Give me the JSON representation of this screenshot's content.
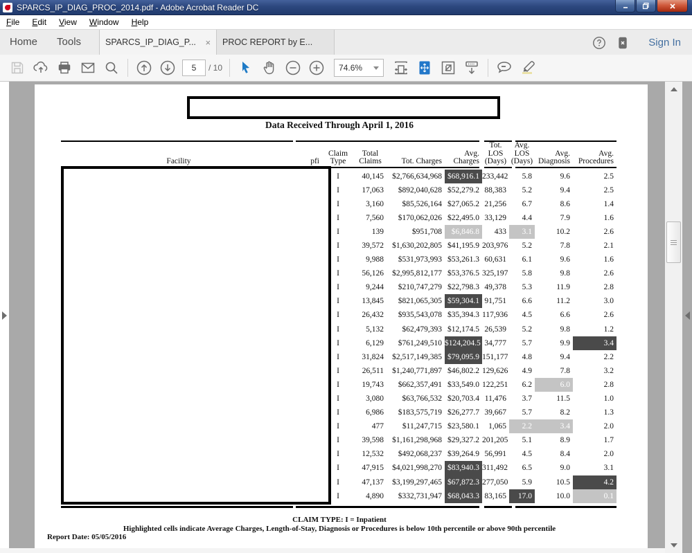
{
  "window": {
    "title": "SPARCS_IP_DIAG_PROC_2014.pdf - Adobe Acrobat Reader DC"
  },
  "menu": {
    "items": [
      "File",
      "Edit",
      "View",
      "Window",
      "Help"
    ]
  },
  "tabs": {
    "home": "Home",
    "tools": "Tools",
    "doc1": "SPARCS_IP_DIAG_P...",
    "doc1_close": "×",
    "doc2": "PROC REPORT by E..."
  },
  "account": {
    "sign_in": "Sign In"
  },
  "toolbar": {
    "page_current": "5",
    "page_total": "/ 10",
    "zoom_level": "74.6%"
  },
  "document": {
    "banner_title": "Data Received Through April 1, 2016",
    "footer_claim_type": "CLAIM TYPE: I = Inpatient",
    "footer_note": "Highlighted cells indicate Average Charges, Length-of-Stay, Diagnosis or Procedures is below 10th percentile or above 90th percentile",
    "report_date": "Report Date: 05/05/2016"
  },
  "table": {
    "headers": [
      "Facility",
      "pfi",
      "Claim\nType",
      "Total\nClaims",
      "Tot. Charges",
      "Avg.\nCharges",
      "Tot.\nLOS\n(Days)",
      "Avg.\nLOS\n(Days)",
      "Avg.\nDiagnosis",
      "Avg.\nProcedures"
    ],
    "highlight_colors": {
      "dark": "#4a4a4a",
      "light": "#c4c4c4"
    },
    "rows": [
      {
        "cells": [
          "I",
          "40,145",
          "$2,766,634,968",
          "$68,916.1",
          "233,442",
          "5.8",
          "9.6",
          "2.5"
        ],
        "hl": [
          null,
          null,
          null,
          "dark",
          null,
          null,
          null,
          null
        ]
      },
      {
        "cells": [
          "I",
          "17,063",
          "$892,040,628",
          "$52,279.2",
          "88,383",
          "5.2",
          "9.4",
          "2.5"
        ],
        "hl": [
          null,
          null,
          null,
          null,
          null,
          null,
          null,
          null
        ]
      },
      {
        "cells": [
          "I",
          "3,160",
          "$85,526,164",
          "$27,065.2",
          "21,256",
          "6.7",
          "8.6",
          "1.4"
        ],
        "hl": [
          null,
          null,
          null,
          null,
          null,
          null,
          null,
          null
        ]
      },
      {
        "cells": [
          "I",
          "7,560",
          "$170,062,026",
          "$22,495.0",
          "33,129",
          "4.4",
          "7.9",
          "1.6"
        ],
        "hl": [
          null,
          null,
          null,
          null,
          null,
          null,
          null,
          null
        ]
      },
      {
        "cells": [
          "I",
          "139",
          "$951,708",
          "$6,846.8",
          "433",
          "3.1",
          "10.2",
          "2.6"
        ],
        "hl": [
          null,
          null,
          null,
          "light",
          null,
          "light",
          null,
          null
        ]
      },
      {
        "cells": [
          "I",
          "39,572",
          "$1,630,202,805",
          "$41,195.9",
          "203,976",
          "5.2",
          "7.8",
          "2.1"
        ],
        "hl": [
          null,
          null,
          null,
          null,
          null,
          null,
          null,
          null
        ]
      },
      {
        "cells": [
          "I",
          "9,988",
          "$531,973,993",
          "$53,261.3",
          "60,631",
          "6.1",
          "9.6",
          "1.6"
        ],
        "hl": [
          null,
          null,
          null,
          null,
          null,
          null,
          null,
          null
        ]
      },
      {
        "cells": [
          "I",
          "56,126",
          "$2,995,812,177",
          "$53,376.5",
          "325,197",
          "5.8",
          "9.8",
          "2.6"
        ],
        "hl": [
          null,
          null,
          null,
          null,
          null,
          null,
          null,
          null
        ]
      },
      {
        "cells": [
          "I",
          "9,244",
          "$210,747,279",
          "$22,798.3",
          "49,378",
          "5.3",
          "11.9",
          "2.8"
        ],
        "hl": [
          null,
          null,
          null,
          null,
          null,
          null,
          null,
          null
        ]
      },
      {
        "cells": [
          "I",
          "13,845",
          "$821,065,305",
          "$59,304.1",
          "91,751",
          "6.6",
          "11.2",
          "3.0"
        ],
        "hl": [
          null,
          null,
          null,
          "dark",
          null,
          null,
          null,
          null
        ]
      },
      {
        "cells": [
          "I",
          "26,432",
          "$935,543,078",
          "$35,394.3",
          "117,936",
          "4.5",
          "6.6",
          "2.6"
        ],
        "hl": [
          null,
          null,
          null,
          null,
          null,
          null,
          null,
          null
        ]
      },
      {
        "cells": [
          "I",
          "5,132",
          "$62,479,393",
          "$12,174.5",
          "26,539",
          "5.2",
          "9.8",
          "1.2"
        ],
        "hl": [
          null,
          null,
          null,
          null,
          null,
          null,
          null,
          null
        ]
      },
      {
        "cells": [
          "I",
          "6,129",
          "$761,249,510",
          "$124,204.5",
          "34,777",
          "5.7",
          "9.9",
          "3.4"
        ],
        "hl": [
          null,
          null,
          null,
          "dark",
          null,
          null,
          null,
          "dark"
        ]
      },
      {
        "cells": [
          "I",
          "31,824",
          "$2,517,149,385",
          "$79,095.9",
          "151,177",
          "4.8",
          "9.4",
          "2.2"
        ],
        "hl": [
          null,
          null,
          null,
          "dark",
          null,
          null,
          null,
          null
        ]
      },
      {
        "cells": [
          "I",
          "26,511",
          "$1,240,771,897",
          "$46,802.2",
          "129,626",
          "4.9",
          "7.8",
          "3.2"
        ],
        "hl": [
          null,
          null,
          null,
          null,
          null,
          null,
          null,
          null
        ]
      },
      {
        "cells": [
          "I",
          "19,743",
          "$662,357,491",
          "$33,549.0",
          "122,251",
          "6.2",
          "6.0",
          "2.8"
        ],
        "hl": [
          null,
          null,
          null,
          null,
          null,
          null,
          "light",
          null
        ]
      },
      {
        "cells": [
          "I",
          "3,080",
          "$63,766,532",
          "$20,703.4",
          "11,476",
          "3.7",
          "11.5",
          "1.0"
        ],
        "hl": [
          null,
          null,
          null,
          null,
          null,
          null,
          null,
          null
        ]
      },
      {
        "cells": [
          "I",
          "6,986",
          "$183,575,719",
          "$26,277.7",
          "39,667",
          "5.7",
          "8.2",
          "1.3"
        ],
        "hl": [
          null,
          null,
          null,
          null,
          null,
          null,
          null,
          null
        ]
      },
      {
        "cells": [
          "I",
          "477",
          "$11,247,715",
          "$23,580.1",
          "1,065",
          "2.2",
          "3.4",
          "2.0"
        ],
        "hl": [
          null,
          null,
          null,
          null,
          null,
          "light",
          "light",
          null
        ]
      },
      {
        "cells": [
          "I",
          "39,598",
          "$1,161,298,968",
          "$29,327.2",
          "201,205",
          "5.1",
          "8.9",
          "1.7"
        ],
        "hl": [
          null,
          null,
          null,
          null,
          null,
          null,
          null,
          null
        ]
      },
      {
        "cells": [
          "I",
          "12,532",
          "$492,068,237",
          "$39,264.9",
          "56,991",
          "4.5",
          "8.4",
          "2.0"
        ],
        "hl": [
          null,
          null,
          null,
          null,
          null,
          null,
          null,
          null
        ]
      },
      {
        "cells": [
          "I",
          "47,915",
          "$4,021,998,270",
          "$83,940.3",
          "311,492",
          "6.5",
          "9.0",
          "3.1"
        ],
        "hl": [
          null,
          null,
          null,
          "dark",
          null,
          null,
          null,
          null
        ]
      },
      {
        "cells": [
          "I",
          "47,137",
          "$3,199,297,465",
          "$67,872.3",
          "277,050",
          "5.9",
          "10.5",
          "4.2"
        ],
        "hl": [
          null,
          null,
          null,
          "dark",
          null,
          null,
          null,
          "dark"
        ]
      },
      {
        "cells": [
          "I",
          "4,890",
          "$332,731,947",
          "$68,043.3",
          "83,165",
          "17.0",
          "10.0",
          "0.1"
        ],
        "hl": [
          null,
          null,
          null,
          "dark",
          null,
          "dark",
          null,
          "light"
        ]
      }
    ]
  }
}
